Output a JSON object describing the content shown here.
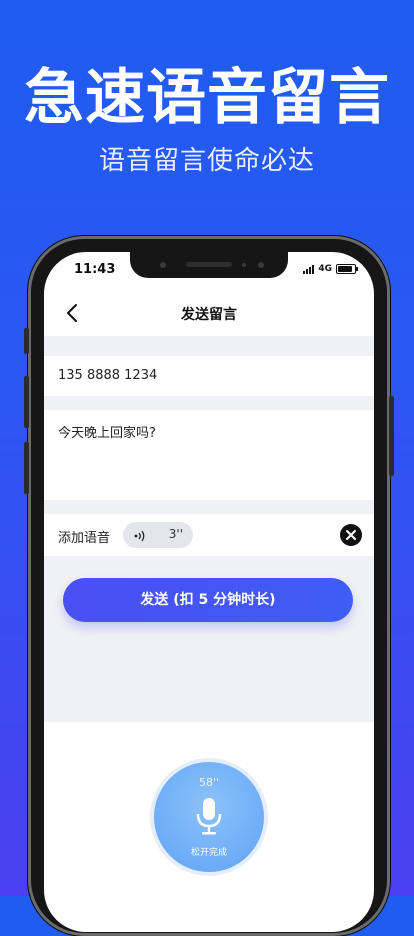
{
  "promo": {
    "headline": "急速语音留言",
    "subline": "语音留言使命必达"
  },
  "status_bar": {
    "time": "11:43",
    "network": "4G"
  },
  "nav": {
    "title": "发送留言"
  },
  "form": {
    "phone": "135 8888 1234",
    "message": "今天晚上回家吗?"
  },
  "voice": {
    "label": "添加语音",
    "duration": "3''"
  },
  "send_button": "发送 (扣 5 分钟时长)",
  "recorder": {
    "countdown": "58''",
    "hint": "松开完成"
  },
  "colors": {
    "background_top": "#1f5cf0",
    "background_bottom": "#4b3ff0",
    "accent": "#4a4ff4"
  }
}
